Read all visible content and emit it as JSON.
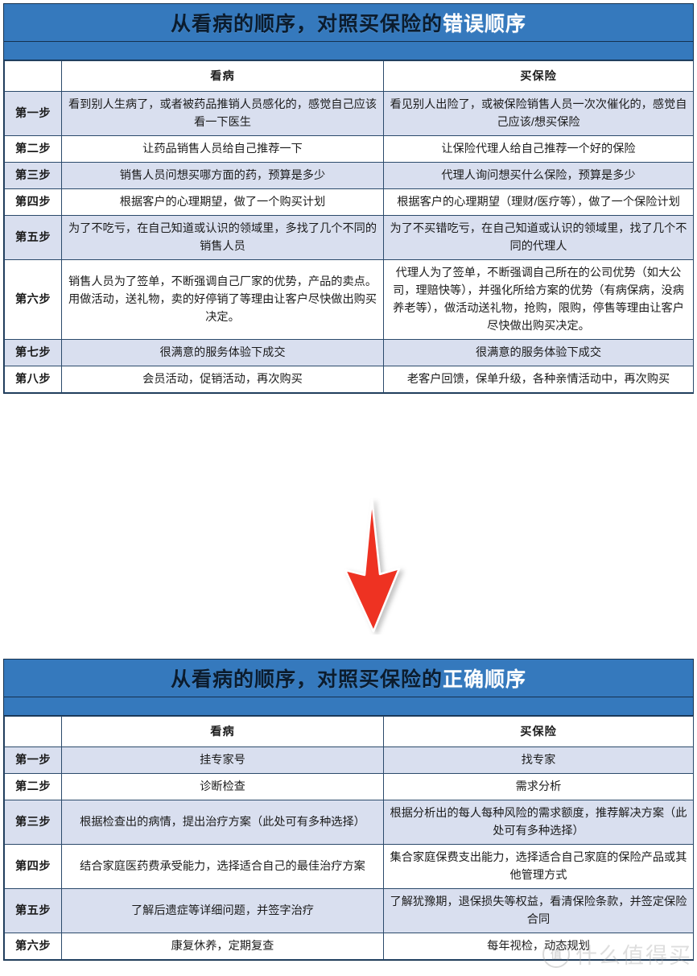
{
  "colors": {
    "header_blue": "#3579bd",
    "border_dark": "#15314f",
    "row_alt": "#d9dfef",
    "header_green": "#4a6b21",
    "arrow_red": "#ee3124"
  },
  "tables": [
    {
      "id": "wrong-order",
      "title_prefix": "从看病的顺序，对照买保险的",
      "title_highlight": "错误顺序",
      "columns": [
        "",
        "看病",
        "买保险"
      ],
      "rows": [
        {
          "step": "第一步",
          "a": "看到别人生病了，或者被药品推销人员感化的，感觉自己应该看一下医生",
          "b": "看见别人出险了，或被保险销售人员一次次催化的，感觉自己应该/想买保险"
        },
        {
          "step": "第二步",
          "a": "让药品销售人员给自己推荐一下",
          "b": "让保险代理人给自己推荐一个好的保险"
        },
        {
          "step": "第三步",
          "a": "销售人员问想买哪方面的药，预算是多少",
          "b": "代理人询问想买什么保险，预算是多少"
        },
        {
          "step": "第四步",
          "a": "根据客户的心理期望，做了一个购买计划",
          "b": "根据客户的心理期望（理财/医疗等），做了一个保险计划"
        },
        {
          "step": "第五步",
          "a": "为了不吃亏，在自己知道或认识的领域里，多找了几个不同的销售人员",
          "b": "为了不买错吃亏，在自己知道或认识的领域里，找了几个不同的代理人"
        },
        {
          "step": "第六步",
          "a": "销售人员为了签单，不断强调自己厂家的优势，产品的卖点。用做活动，送礼物，卖的好停销了等理由让客户尽快做出购买决定。",
          "b": "代理人为了签单，不断强调自己所在的公司优势（如大公司，理赔快等），并强化所给方案的优势（有病保病，没病养老等），做活动送礼物，抢购，限购，停售等理由让客户尽快做出购买决定。"
        },
        {
          "step": "第七步",
          "a": "很满意的服务体验下成交",
          "b": "很满意的服务体验下成交"
        },
        {
          "step": "第八步",
          "a": "会员活动，促销活动，再次购买",
          "b": "老客户回馈，保单升级，各种亲情活动中，再次购买"
        }
      ]
    },
    {
      "id": "correct-order",
      "title_prefix": "从看病的顺序，对照买保险的",
      "title_highlight": "正确顺序",
      "columns": [
        "",
        "看病",
        "买保险"
      ],
      "rows": [
        {
          "step": "第一步",
          "a": "挂专家号",
          "b": "找专家"
        },
        {
          "step": "第二步",
          "a": "诊断检查",
          "b": "需求分析"
        },
        {
          "step": "第三步",
          "a": "根据检查出的病情，提出治疗方案（此处可有多种选择）",
          "b": "根据分析出的每人每种风险的需求额度，推荐解决方案（此处可有多种选择）"
        },
        {
          "step": "第四步",
          "a": "结合家庭医药费承受能力，选择适合自己的最佳治疗方案",
          "b": "集合家庭保费支出能力，选择适合自己家庭的保险产品或其他管理方式"
        },
        {
          "step": "第五步",
          "a": "了解后遗症等详细问题，并签字治疗",
          "b": "了解犹豫期，退保损失等权益，看清保险条款，并签定保险合同"
        },
        {
          "step": "第六步",
          "a": "康复休养，定期复查",
          "b": "每年视检，动态规划"
        }
      ]
    }
  ],
  "arrow": {
    "direction": "down",
    "color": "#ee3124"
  },
  "watermark": {
    "text": "什么值得买",
    "logo_glyph": "值"
  }
}
